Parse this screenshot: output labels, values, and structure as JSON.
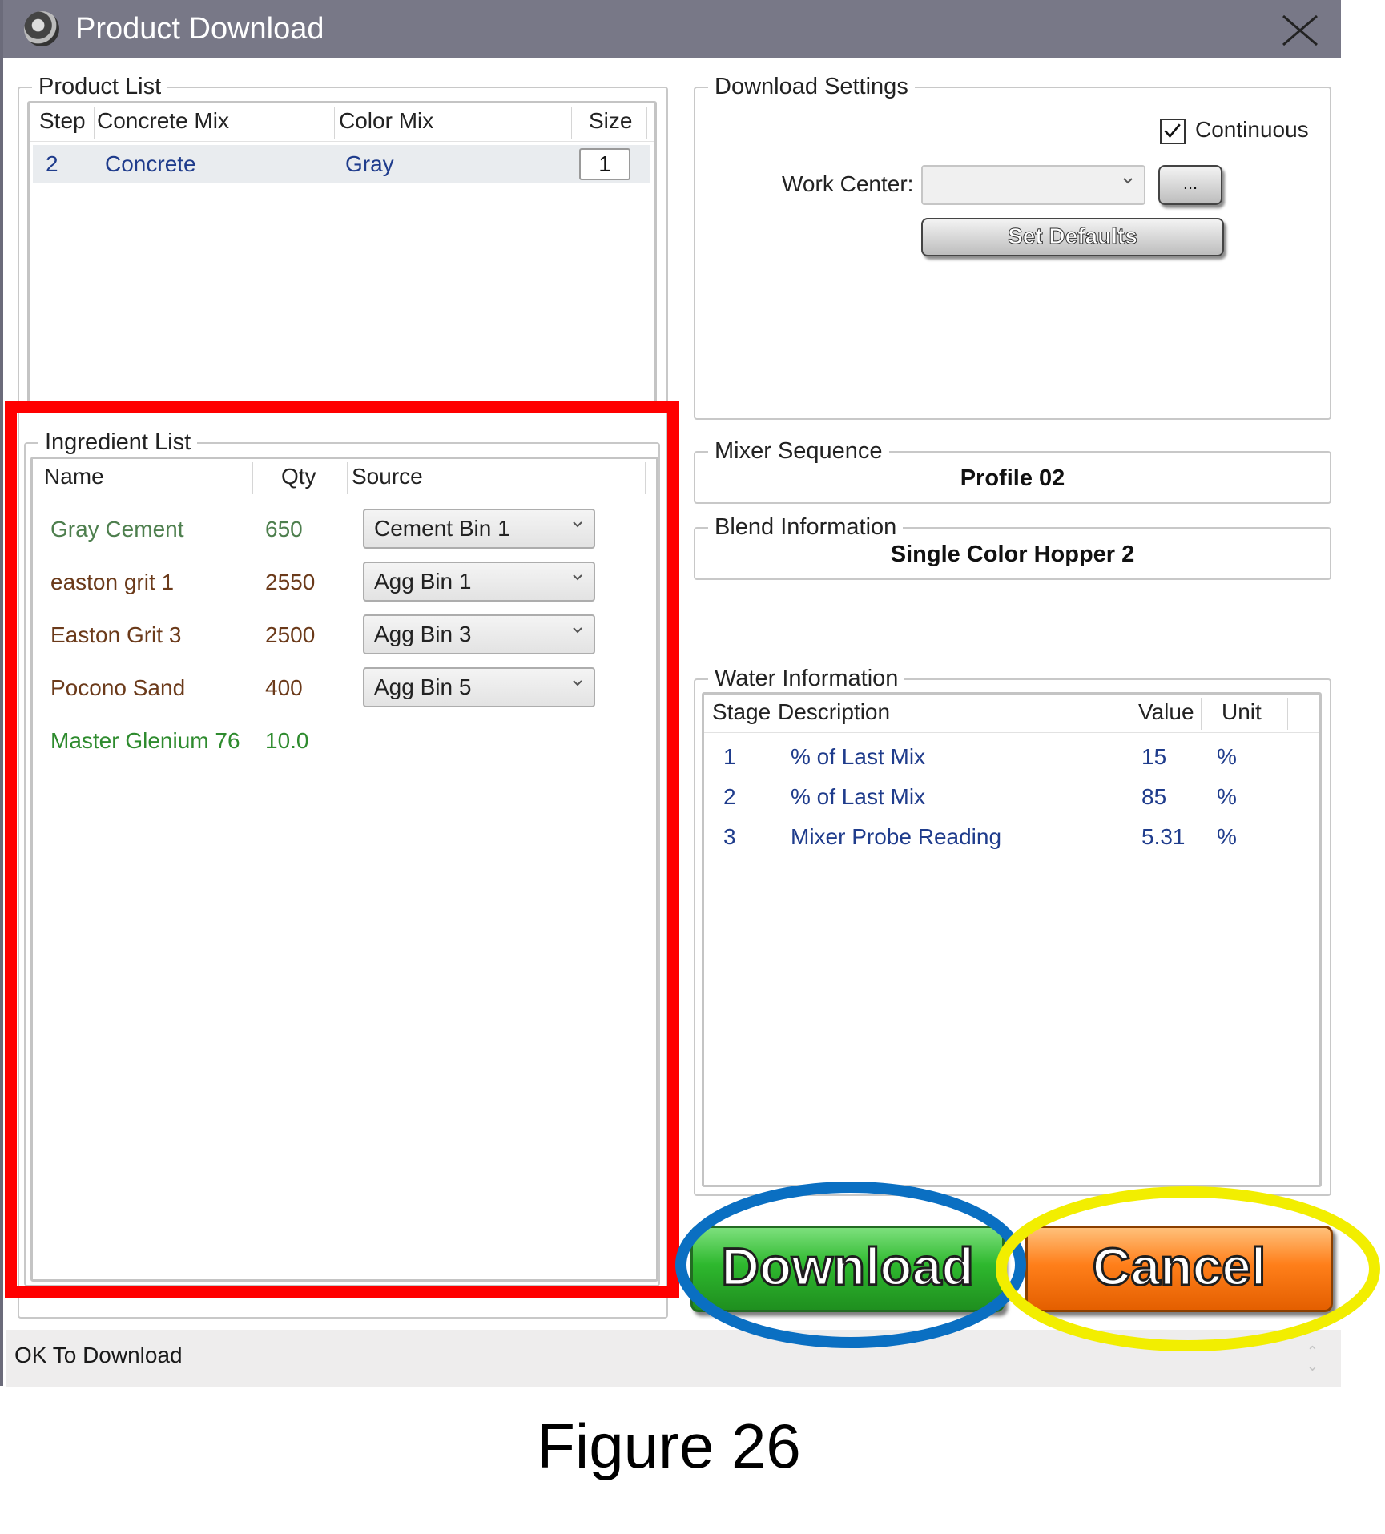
{
  "window": {
    "title": "Product Download",
    "close_icon": "close-icon",
    "app_icon": "brain-icon"
  },
  "product_list": {
    "legend": "Product List",
    "columns": [
      "Step",
      "Concrete Mix",
      "Color Mix",
      "Size"
    ],
    "rows": [
      {
        "step": "2",
        "concrete_mix": "Concrete",
        "color_mix": "Gray",
        "size": "1"
      }
    ]
  },
  "download_settings": {
    "legend": "Download Settings",
    "continuous_label": "Continuous",
    "continuous_checked": true,
    "work_center_label": "Work Center:",
    "work_center_value": "",
    "browse_label": "...",
    "set_defaults_label": "Set Defaults"
  },
  "ingredient_list": {
    "legend": "Ingredient List",
    "columns": [
      "Name",
      "Qty",
      "Source"
    ],
    "rows": [
      {
        "name": "Gray Cement",
        "qty": "650",
        "source": "Cement Bin 1",
        "color": "#4e7f4e"
      },
      {
        "name": "easton grit 1",
        "qty": "2550",
        "source": "Agg Bin 1",
        "color": "#6b3a1a"
      },
      {
        "name": "Easton Grit 3",
        "qty": "2500",
        "source": "Agg Bin 3",
        "color": "#6b3a1a"
      },
      {
        "name": "Pocono Sand",
        "qty": "400",
        "source": "Agg Bin 5",
        "color": "#6b3a1a"
      },
      {
        "name": "Master Glenium 76",
        "qty": "10.0",
        "source": "",
        "color": "#2e8b2e"
      }
    ]
  },
  "mixer_sequence": {
    "legend": "Mixer Sequence",
    "value": "Profile 02"
  },
  "blend_information": {
    "legend": "Blend Information",
    "value": "Single Color Hopper 2"
  },
  "water_information": {
    "legend": "Water Information",
    "columns": [
      "Stage",
      "Description",
      "Value",
      "Unit"
    ],
    "rows": [
      {
        "stage": "1",
        "description": "% of Last Mix",
        "value": "15",
        "unit": "%"
      },
      {
        "stage": "2",
        "description": "% of Last Mix",
        "value": "85",
        "unit": "%"
      },
      {
        "stage": "3",
        "description": "Mixer Probe Reading",
        "value": "5.31",
        "unit": "%"
      }
    ]
  },
  "buttons": {
    "download": "Download",
    "cancel": "Cancel"
  },
  "status": {
    "text": "OK To Download"
  },
  "caption": "Figure 26",
  "colors": {
    "titlebar": "#787887",
    "grid_text_blue": "#1f3c8c",
    "download_green": "#2eb82e",
    "cancel_orange": "#ff7f1a",
    "annotation_red": "#ff0000",
    "annotation_blue": "#0a6fc2",
    "annotation_yellow": "#f2ee00"
  }
}
